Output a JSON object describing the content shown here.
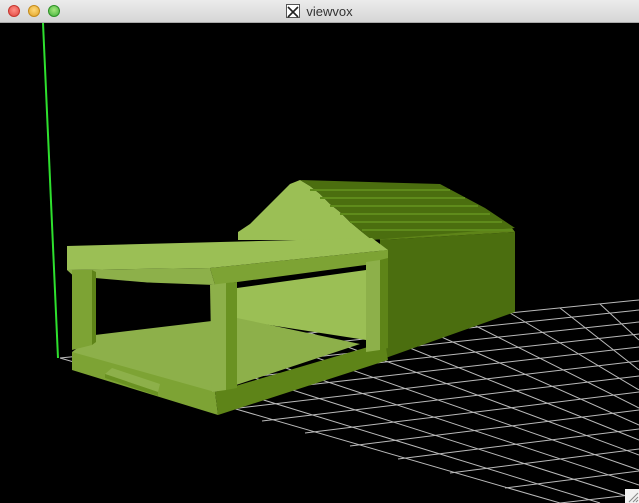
{
  "window": {
    "title": "viewvox",
    "title_icon": "x11-icon"
  },
  "viewport": {
    "background": "#000000",
    "model_color_light": "#9bbf55",
    "model_color_mid": "#7da334",
    "model_color_dark": "#4b6e0f",
    "grid_color": "#cfcfcf",
    "y_axis_color": "#2ee02e"
  }
}
